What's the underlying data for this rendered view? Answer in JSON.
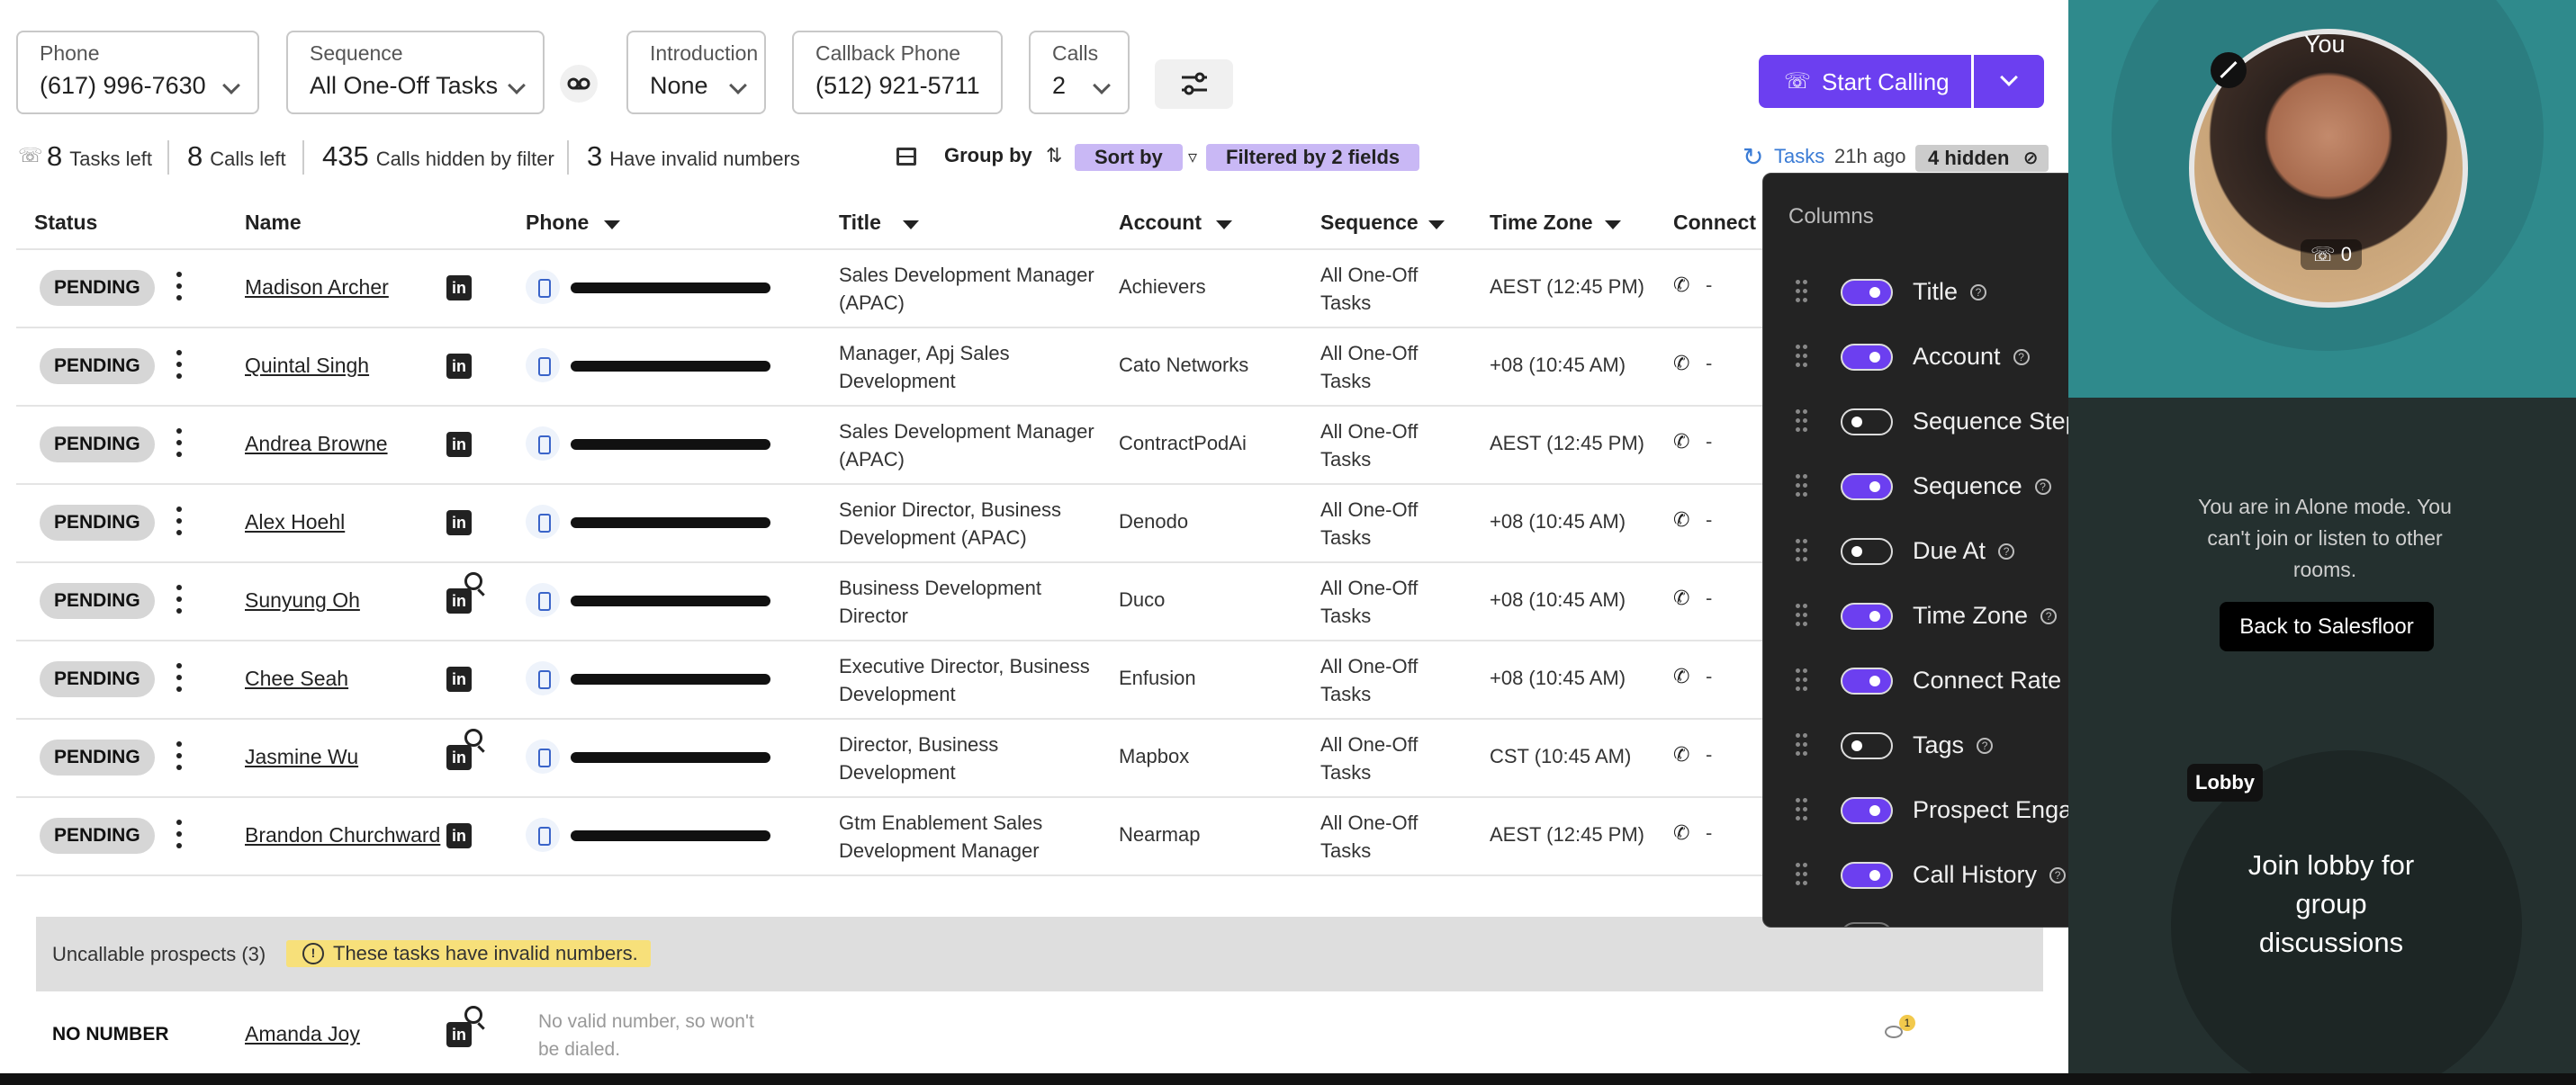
{
  "toolbar": {
    "phone": {
      "label": "Phone",
      "value": "(617) 996-7630"
    },
    "sequence": {
      "label": "Sequence",
      "value": "All One-Off Tasks"
    },
    "introduction": {
      "label": "Introduction",
      "value": "None"
    },
    "callback": {
      "label": "Callback Phone",
      "value": "(512) 921-5711"
    },
    "calls": {
      "label": "Calls",
      "value": "2"
    },
    "start_calling": "Start Calling"
  },
  "stats": {
    "tasks_left_num": "8",
    "tasks_left": "Tasks left",
    "calls_left_num": "8",
    "calls_left": "Calls left",
    "hidden_num": "435",
    "hidden": "Calls hidden by filter",
    "invalid_num": "3",
    "invalid": "Have invalid numbers",
    "group_by": "Group by",
    "sort_by": "Sort by",
    "filtered": "Filtered by 2 fields",
    "tasks_link": "Tasks",
    "ago": "21h ago",
    "hidden_badge": "4 hidden"
  },
  "table": {
    "headers": {
      "status": "Status",
      "name": "Name",
      "phone": "Phone",
      "title": "Title",
      "account": "Account",
      "sequence": "Sequence",
      "timezone": "Time Zone",
      "connect": "Connect R"
    },
    "rows": [
      {
        "status": "PENDING",
        "name": "Madison Archer",
        "title": "Sales Development Manager (APAC)",
        "account": "Achievers",
        "sequence": "All One-Off Tasks",
        "tz": "AEST (12:45 PM)",
        "connect": "-"
      },
      {
        "status": "PENDING",
        "name": "Quintal Singh",
        "title": "Manager, Apj Sales Development",
        "account": "Cato Networks",
        "sequence": "All One-Off Tasks",
        "tz": "+08 (10:45 AM)",
        "connect": "-"
      },
      {
        "status": "PENDING",
        "name": "Andrea Browne",
        "title": "Sales Development Manager (APAC)",
        "account": "ContractPodAi",
        "sequence": "All One-Off Tasks",
        "tz": "AEST (12:45 PM)",
        "connect": "-"
      },
      {
        "status": "PENDING",
        "name": "Alex Hoehl",
        "title": "Senior Director, Business Development (APAC)",
        "account": "Denodo",
        "sequence": "All One-Off Tasks",
        "tz": "+08 (10:45 AM)",
        "connect": "-"
      },
      {
        "status": "PENDING",
        "name": "Sunyung Oh",
        "title": "Business Development Director",
        "account": "Duco",
        "sequence": "All One-Off Tasks",
        "tz": "+08 (10:45 AM)",
        "connect": "-"
      },
      {
        "status": "PENDING",
        "name": "Chee Seah",
        "title": "Executive Director, Business Development",
        "account": "Enfusion",
        "sequence": "All One-Off Tasks",
        "tz": "+08 (10:45 AM)",
        "connect": "-"
      },
      {
        "status": "PENDING",
        "name": "Jasmine Wu",
        "title": "Director, Business Development",
        "account": "Mapbox",
        "sequence": "All One-Off Tasks",
        "tz": "CST (10:45 AM)",
        "connect": "-"
      },
      {
        "status": "PENDING",
        "name": "Brandon Churchward",
        "title": "Gtm Enablement Sales Development Manager",
        "account": "Nearmap",
        "sequence": "All One-Off Tasks",
        "tz": "AEST (12:45 PM)",
        "connect": "-"
      }
    ]
  },
  "uncallable": {
    "title": "Uncallable prospects (3)",
    "warning": "These tasks have invalid numbers.",
    "row": {
      "status": "NO NUMBER",
      "name": "Amanda Joy",
      "note": "No valid number, so won't be dialed.",
      "badge": "1"
    }
  },
  "columns_panel": {
    "title": "Columns",
    "items": [
      {
        "label": "Title",
        "on": true
      },
      {
        "label": "Account",
        "on": true
      },
      {
        "label": "Sequence Step",
        "on": false
      },
      {
        "label": "Sequence",
        "on": true
      },
      {
        "label": "Due At",
        "on": false
      },
      {
        "label": "Time Zone",
        "on": true
      },
      {
        "label": "Connect Rate",
        "on": true
      },
      {
        "label": "Tags",
        "on": false
      },
      {
        "label": "Prospect Engagement",
        "on": true
      },
      {
        "label": "Call History",
        "on": true
      }
    ]
  },
  "room": {
    "you": "You",
    "count": "0",
    "alone": "You are in Alone mode. You can't join or listen to other rooms.",
    "back": "Back to Salesfloor",
    "lobby": "Lobby",
    "lobby_text": "Join lobby for group discussions"
  },
  "colors": {
    "accent": "#6c3ff0",
    "chip": "#c9b8f5",
    "teal": "#2f8a8c",
    "warn": "#f7e07a"
  }
}
